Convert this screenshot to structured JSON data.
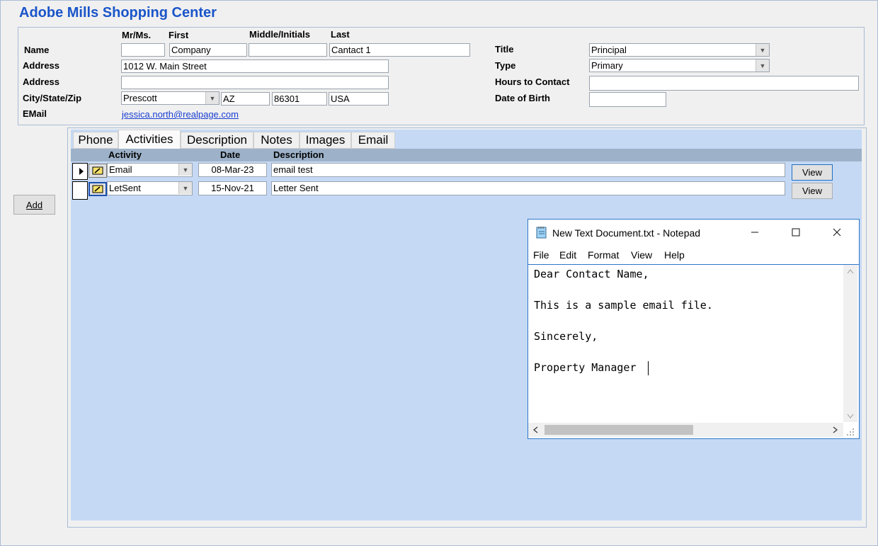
{
  "app": {
    "title": "Adobe Mills Shopping Center"
  },
  "contact": {
    "headers": {
      "mr": "Mr/Ms.",
      "first": "First",
      "middle": "Middle/Initials",
      "last": "Last"
    },
    "labels": {
      "name": "Name",
      "address1": "Address",
      "address2": "Address",
      "city": "City/State/Zip",
      "email": "EMail"
    },
    "values": {
      "mr": "",
      "first": "Company",
      "middle": "",
      "last": "Cantact 1",
      "address1": "1012 W. Main Street",
      "address2": "",
      "city": "Prescott",
      "state": "AZ",
      "zip": "86301",
      "country": "USA",
      "email": "jessica.north@realpage.com"
    },
    "right_labels": {
      "title": "Title",
      "type": "Type",
      "hours": "Hours to Contact",
      "dob": "Date of Birth"
    },
    "right_values": {
      "title": "Principal",
      "type": "Primary",
      "hours": "",
      "dob": ""
    }
  },
  "add_button": "Add",
  "tabs": [
    "Phone",
    "Activities",
    "Description",
    "Notes",
    "Images",
    "Email"
  ],
  "active_tab": "Activities",
  "activities": {
    "columns": {
      "activity": "Activity",
      "date": "Date",
      "description": "Description"
    },
    "rows": [
      {
        "activity": "Email",
        "date": "08-Mar-23",
        "description": "email test",
        "view": "View"
      },
      {
        "activity": "LetSent",
        "date": "15-Nov-21",
        "description": "Letter Sent",
        "view": "View"
      }
    ]
  },
  "notepad": {
    "title": "New Text Document.txt - Notepad",
    "menu": [
      "File",
      "Edit",
      "Format",
      "View",
      "Help"
    ],
    "lines": [
      "Dear Contact Name,",
      "This is a sample email file.",
      "Sincerely,",
      "Property Manager"
    ]
  },
  "colors": {
    "title": "#1a55c9",
    "panel_blue": "#c5d9f5",
    "header_strip": "#9db2c9",
    "link": "#1a3fd1"
  },
  "icons": [
    "edit-note-icon",
    "row-pointer-icon",
    "notepad-app-icon",
    "minimize-icon",
    "maximize-icon",
    "close-icon",
    "chevron-down-icon"
  ]
}
